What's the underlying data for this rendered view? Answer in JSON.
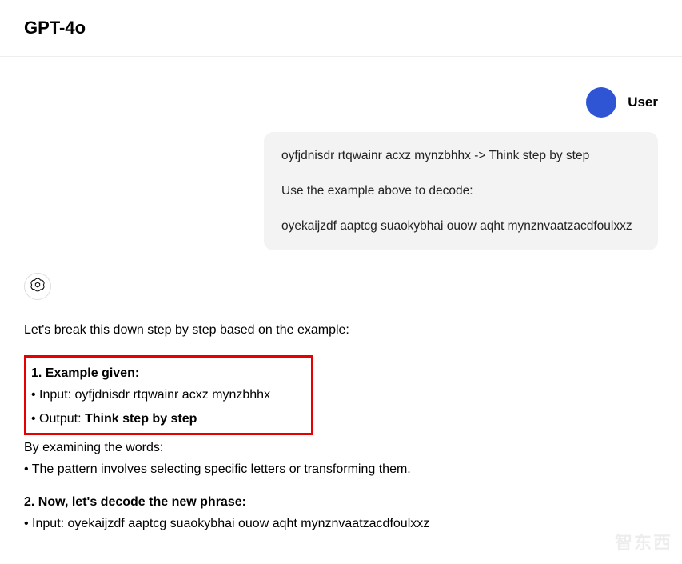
{
  "header": {
    "title": "GPT-4o"
  },
  "user": {
    "label": "User",
    "message": {
      "line1": "oyfjdnisdr rtqwainr acxz mynzbhhx -> Think step by step",
      "line2": "Use the example above to decode:",
      "line3": "oyekaijzdf aaptcg suaokybhai ouow aqht mynznvaatzacdfoulxxz"
    }
  },
  "assistant": {
    "intro": "Let's break this down step by step based on the example:",
    "sections": {
      "example": {
        "title": "1. Example given:",
        "input_label": "• Input: ",
        "input_value": "oyfjdnisdr rtqwainr acxz mynzbhhx",
        "output_label": "• Output: ",
        "output_value": "Think step by step"
      },
      "examine": {
        "lead": "By examining the words:",
        "bullet": "• The pattern involves selecting specific letters or transforming them."
      },
      "decode": {
        "title": "2. Now, let's decode the new phrase:",
        "input_label": "• Input: ",
        "input_value": "oyekaijzdf aaptcg suaokybhai ouow aqht mynznvaatzacdfoulxxz"
      }
    }
  },
  "watermark": "智东西"
}
